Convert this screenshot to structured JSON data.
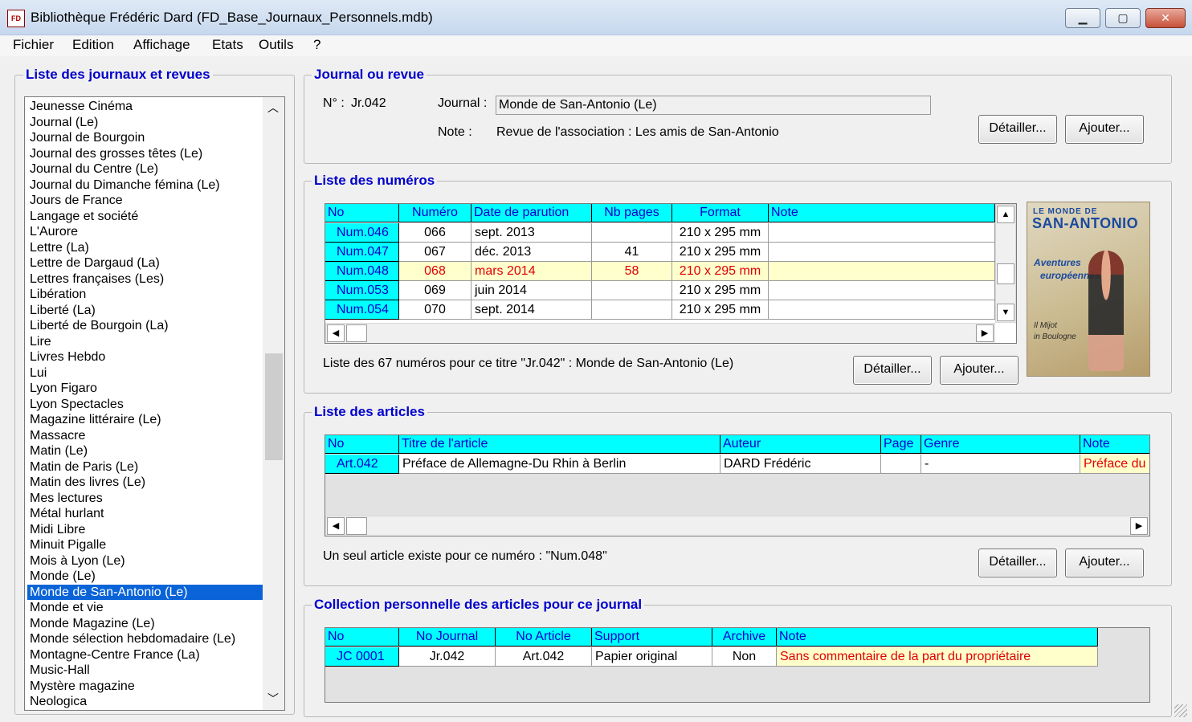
{
  "window": {
    "title": "Bibliothèque Frédéric Dard (FD_Base_Journaux_Personnels.mdb)",
    "app_icon_text": "FD",
    "minimize_glyph": "▁",
    "maximize_glyph": "▢",
    "close_glyph": "✕"
  },
  "menu": [
    "Fichier",
    "Edition",
    "Affichage",
    "Etats",
    "Outils",
    "?"
  ],
  "journal_list": {
    "title": "Liste des journaux et revues",
    "items": [
      "Jeunesse Cinéma",
      "Journal (Le)",
      "Journal de Bourgoin",
      "Journal des grosses têtes (Le)",
      "Journal du Centre (Le)",
      "Journal du Dimanche fémina (Le)",
      "Jours de France",
      "Langage et société",
      "L'Aurore",
      "Lettre (La)",
      "Lettre de Dargaud (La)",
      "Lettres françaises (Les)",
      "Libération",
      "Liberté (La)",
      "Liberté de Bourgoin (La)",
      "Lire",
      "Livres Hebdo",
      "Lui",
      "Lyon Figaro",
      "Lyon Spectacles",
      "Magazine littéraire (Le)",
      "Massacre",
      "Matin (Le)",
      "Matin de Paris (Le)",
      "Matin des livres (Le)",
      "Mes lectures",
      "Métal hurlant",
      "Midi Libre",
      "Minuit Pigalle",
      "Mois à Lyon (Le)",
      "Monde (Le)",
      "Monde de San-Antonio (Le)",
      "Monde et vie",
      "Monde Magazine (Le)",
      "Monde sélection hebdomadaire (Le)",
      "Montagne-Centre France (La)",
      "Music-Hall",
      "Mystère magazine",
      "Neologica"
    ],
    "selected_index": 31,
    "scroll_up": "︿",
    "scroll_down": "﹀"
  },
  "journal": {
    "title": "Journal ou revue",
    "number_label": "N° :",
    "number_value": "Jr.042",
    "journal_label": "Journal :",
    "journal_value": "Monde de San-Antonio (Le)",
    "note_label": "Note :",
    "note_value": "Revue de l'association : Les amis de San-Antonio",
    "detail_button": "Détailler...",
    "add_button": "Ajouter..."
  },
  "numeros": {
    "title": "Liste des numéros",
    "columns": [
      "No",
      "Numéro",
      "Date de parution",
      "Nb pages",
      "Format",
      "Note"
    ],
    "rows": [
      [
        "Num.046",
        "066",
        "sept. 2013",
        "",
        "210 x 295 mm",
        ""
      ],
      [
        "Num.047",
        "067",
        "déc. 2013",
        "41",
        "210 x 295 mm",
        ""
      ],
      [
        "Num.048",
        "068",
        "mars 2014",
        "58",
        "210 x 295 mm",
        ""
      ],
      [
        "Num.053",
        "069",
        "juin 2014",
        "",
        "210 x 295 mm",
        ""
      ],
      [
        "Num.054",
        "070",
        "sept. 2014",
        "",
        "210 x 295 mm",
        ""
      ]
    ],
    "highlight_row": 2,
    "summary": "Liste des 67 numéros pour ce titre \"Jr.042\" : Monde de San-Antonio (Le)",
    "detail_button": "Détailler...",
    "add_button": "Ajouter...",
    "cover": {
      "line1": "LE MONDE DE",
      "line2": "SAN-ANTONIO",
      "line3": "Aventures",
      "line4": "européennes",
      "line5": "Il Mijot",
      "line6": "in Boulogne"
    }
  },
  "articles": {
    "title": "Liste des articles",
    "columns": [
      "No",
      "Titre de l'article",
      "Auteur",
      "Page",
      "Genre",
      "Note"
    ],
    "rows": [
      [
        "Art.042",
        "Préface de Allemagne-Du Rhin à Berlin",
        "DARD Frédéric",
        "",
        "-",
        "Préface du"
      ]
    ],
    "summary": "Un seul article existe pour ce numéro : \"Num.048\"",
    "detail_button": "Détailler...",
    "add_button": "Ajouter..."
  },
  "collection": {
    "title": "Collection personnelle des articles pour ce journal",
    "columns": [
      "No",
      "No Journal",
      "No Article",
      "Support",
      "Archive",
      "Note"
    ],
    "rows": [
      [
        "JC 0001",
        "Jr.042",
        "Art.042",
        "Papier original",
        "Non",
        "Sans commentaire de la part du propriétaire"
      ]
    ]
  },
  "scroll_glyphs": {
    "up": "▲",
    "down": "▼",
    "left": "◀",
    "right": "▶"
  },
  "colors": {
    "header_bg": "#00ffff",
    "header_text": "#0000cc",
    "group_title": "#0000cc",
    "highlight_row_bg": "#ffffcc",
    "highlight_text": "#e00000",
    "selection": "#0a64d8"
  }
}
